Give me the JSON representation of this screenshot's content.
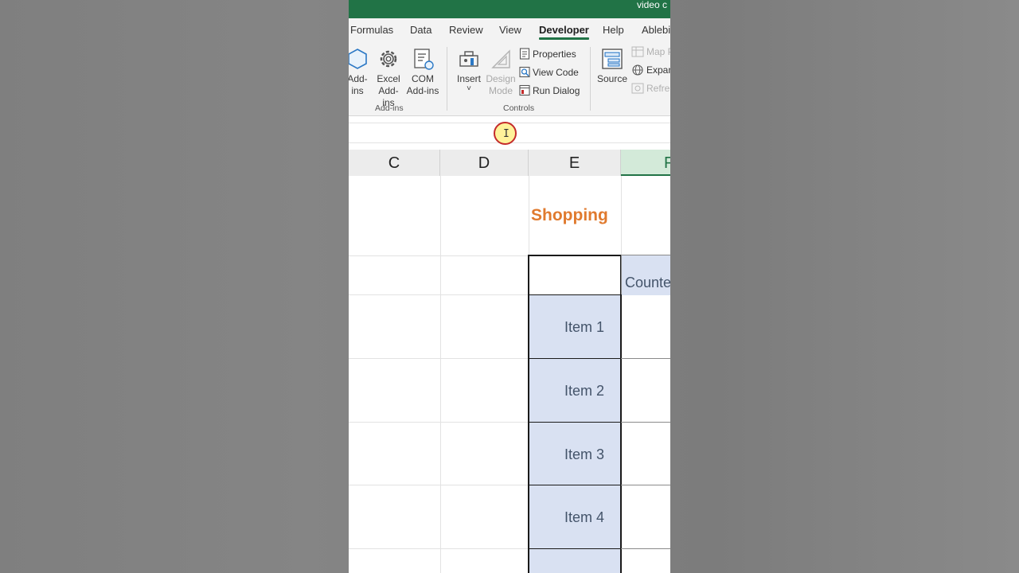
{
  "window": {
    "title_fragment": "video c"
  },
  "tabs": [
    {
      "label": "Formulas",
      "active": false
    },
    {
      "label": "Data",
      "active": false
    },
    {
      "label": "Review",
      "active": false
    },
    {
      "label": "View",
      "active": false
    },
    {
      "label": "Developer",
      "active": true
    },
    {
      "label": "Help",
      "active": false
    },
    {
      "label": "Ablebi",
      "active": false
    }
  ],
  "ribbon": {
    "addins_group": {
      "label": "Add-ins",
      "buttons": [
        {
          "line1": "Add-",
          "line2": "ins",
          "icon": "addins-icon"
        },
        {
          "line1": "Excel",
          "line2": "Add-ins",
          "icon": "gear-icon"
        },
        {
          "line1": "COM",
          "line2": "Add-ins",
          "icon": "com-addins-icon"
        }
      ]
    },
    "controls_group": {
      "label": "Controls",
      "insert": {
        "label": "Insert",
        "icon": "toolbox-icon",
        "caret": "˅"
      },
      "design_mode": {
        "line1": "Design",
        "line2": "Mode",
        "icon": "triangle-ruler-icon",
        "disabled": true
      },
      "properties": "Properties",
      "view_code": "View Code",
      "run_dialog": "Run Dialog"
    },
    "xml_group": {
      "source": "Source",
      "map_properties": "Map P",
      "expansion_packs": "Expan",
      "refresh_data": "Refre"
    }
  },
  "cursor": {
    "glyph": "I"
  },
  "columns": [
    "C",
    "D",
    "E",
    "F"
  ],
  "sheet": {
    "heading": "Shopping",
    "counter_header": "Counte",
    "items": [
      "Item 1",
      "Item 2",
      "Item 3",
      "Item 4"
    ]
  },
  "colors": {
    "accent": "#217346",
    "heading": "#e07a2e",
    "item_fill": "#d9e1f2",
    "item_text": "#44546a"
  }
}
